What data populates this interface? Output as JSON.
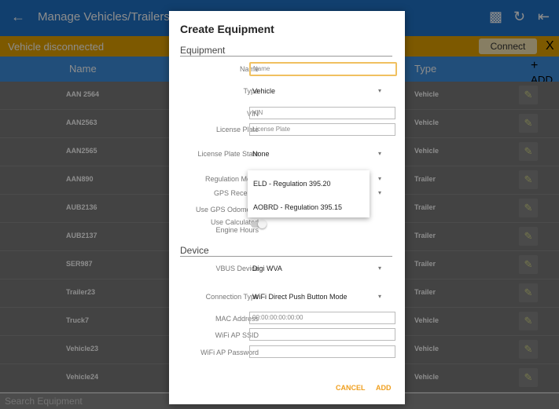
{
  "appbar": {
    "back_icon": "arrow-left-icon",
    "title": "Manage Vehicles/Trailers",
    "icons": [
      "report-icon",
      "refresh-icon",
      "logout-icon"
    ]
  },
  "banner": {
    "message": "Vehicle disconnected",
    "connect_label": "Connect",
    "close_label": "X"
  },
  "table": {
    "headers": {
      "name": "Name",
      "type": "Type",
      "add": "+",
      "add_caption": "ADD"
    },
    "rows": [
      {
        "name": "AAN 2564",
        "type": "Vehicle"
      },
      {
        "name": "AAN2563",
        "type": "Vehicle"
      },
      {
        "name": "AAN2565",
        "type": "Vehicle"
      },
      {
        "name": "AAN890",
        "type": "Trailer"
      },
      {
        "name": "AUB2136",
        "type": "Trailer"
      },
      {
        "name": "AUB2137",
        "type": "Trailer"
      },
      {
        "name": "SER987",
        "type": "Trailer"
      },
      {
        "name": "Trailer23",
        "type": "Trailer"
      },
      {
        "name": "Truck7",
        "type": "Vehicle"
      },
      {
        "name": "Vehicle23",
        "type": "Vehicle"
      },
      {
        "name": "Vehicle24",
        "type": "Vehicle"
      }
    ]
  },
  "search": {
    "placeholder": "Search Equipment"
  },
  "dialog": {
    "title": "Create Equipment",
    "equipment_section": "Equipment",
    "name_label": "Name",
    "name_placeholder": "Name",
    "type_label": "Type",
    "type_value": "Vehicle",
    "vin_label": "VIN",
    "vin_placeholder": "VIN",
    "plate_label": "License Plate",
    "plate_placeholder": "License Plate",
    "plate_state_label": "License Plate State",
    "plate_state_value": "None",
    "regulation_label": "Regulation Mode",
    "gps_receiver_label": "GPS Receiver",
    "gps_odometer_label": "Use GPS Odometer",
    "engine_hours_label": "Use Calculated Engine Hours",
    "regulation_options": [
      "ELD - Regulation 395.20",
      "AOBRD - Regulation 395.15"
    ],
    "device_section": "Device",
    "vbus_label": "VBUS Device",
    "vbus_value": "Digi WVA",
    "connection_label": "Connection Type",
    "connection_value": "WiFi Direct Push Button Mode",
    "mac_label": "MAC Address",
    "mac_value": "00:00:00:00:00:00",
    "ssid_label": "WiFi AP SSID",
    "ssid_value": "",
    "password_label": "WiFi AP Password",
    "password_value": "",
    "cancel_label": "CANCEL",
    "add_label": "ADD"
  }
}
